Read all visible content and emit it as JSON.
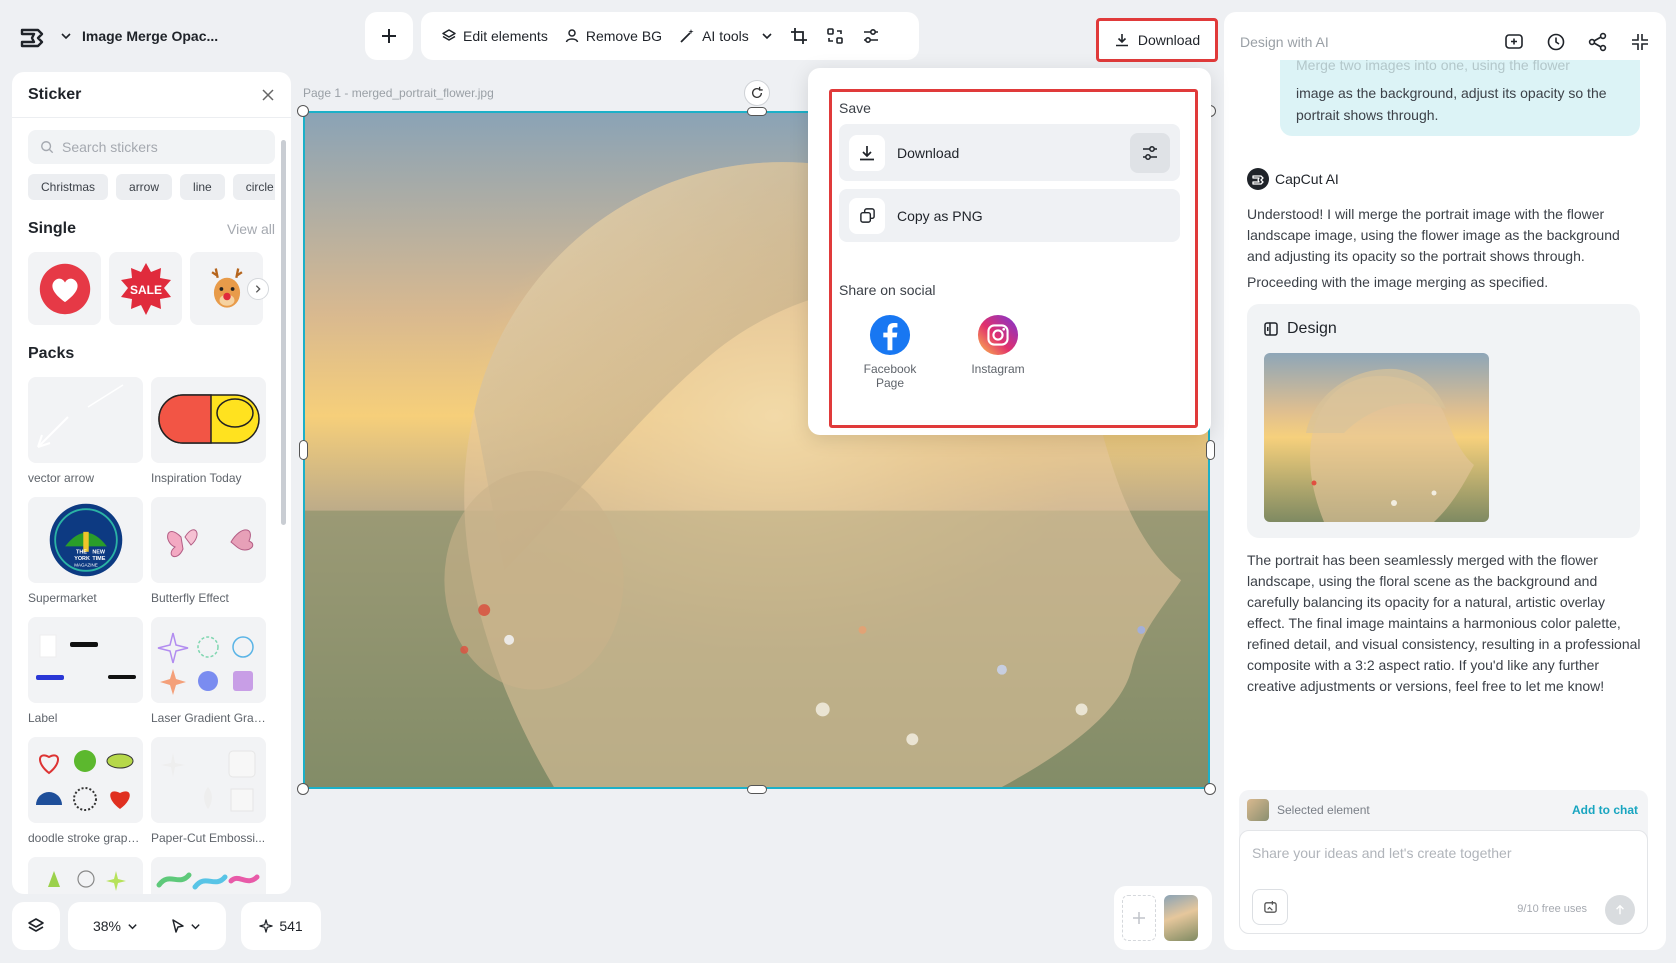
{
  "header": {
    "doc_title": "Image Merge Opac...",
    "toolbar": {
      "edit_elements": "Edit elements",
      "remove_bg": "Remove BG",
      "ai_tools": "AI tools"
    },
    "download_label": "Download"
  },
  "right_panel": {
    "title": "Design with AI"
  },
  "sticker_panel": {
    "title": "Sticker",
    "search_placeholder": "Search stickers",
    "chips": [
      "Christmas",
      "arrow",
      "line",
      "circle"
    ],
    "single_heading": "Single",
    "view_all": "View all",
    "single_items": [
      "heart-sticker",
      "sale-sticker",
      "reindeer-sticker"
    ],
    "sale_text": "SALE",
    "packs_heading": "Packs",
    "packs": [
      {
        "label": "vector arrow"
      },
      {
        "label": "Inspiration Today"
      },
      {
        "label": "Supermarket"
      },
      {
        "label": "Butterfly Effect"
      },
      {
        "label": "Label"
      },
      {
        "label": "Laser Gradient Grap..."
      },
      {
        "label": "doodle stroke graphi..."
      },
      {
        "label": "Paper-Cut Embossi..."
      }
    ],
    "nyt_badge": {
      "line1": "THE",
      "line2": "NEW",
      "line3": "YORK",
      "line4": "TIME",
      "line5": "MAGAZINE"
    }
  },
  "canvas": {
    "page_label": "Page 1 -  merged_portrait_flower.jpg"
  },
  "bottom_bar": {
    "zoom": "38%",
    "credits": "541"
  },
  "download_popup": {
    "save_label": "Save",
    "download_item": "Download",
    "copy_item": "Copy as PNG",
    "social_label": "Share on social",
    "socials": [
      {
        "name": "Facebook Page",
        "line1": "Facebook",
        "line2": "Page",
        "color": "#1877f2"
      },
      {
        "name": "Instagram",
        "line1": "Instagram",
        "line2": "",
        "color": "#e1306c"
      }
    ]
  },
  "chat": {
    "user_message_faded": "Merge two images into one, using the flower",
    "user_message": "image as the background, adjust its opacity so the portrait shows through.",
    "ai_name": "CapCut AI",
    "ai_message_1": "Understood! I will merge the portrait image with the flower landscape image, using the flower image as the background and adjusting its opacity so the portrait shows through.",
    "ai_message_2": "Proceeding with the image merging as specified.",
    "design_title": "Design",
    "ai_message_3": "The portrait has been seamlessly merged with the flower landscape, using the floral scene as the background and carefully balancing its opacity for a natural, artistic overlay effect. The final image maintains a harmonious color palette, refined detail, and visual consistency, resulting in a professional composite with a 3:2 aspect ratio. If you'd like any further creative adjustments or versions, feel free to let me know!",
    "selected_element": "Selected element",
    "add_to_chat": "Add to chat",
    "input_placeholder": "Share your ideas and let's create together",
    "free_uses": "9/10 free uses"
  },
  "colors": {
    "accent": "#18a5c0",
    "highlight": "#e03a3a",
    "selection": "#1cb0c8"
  }
}
